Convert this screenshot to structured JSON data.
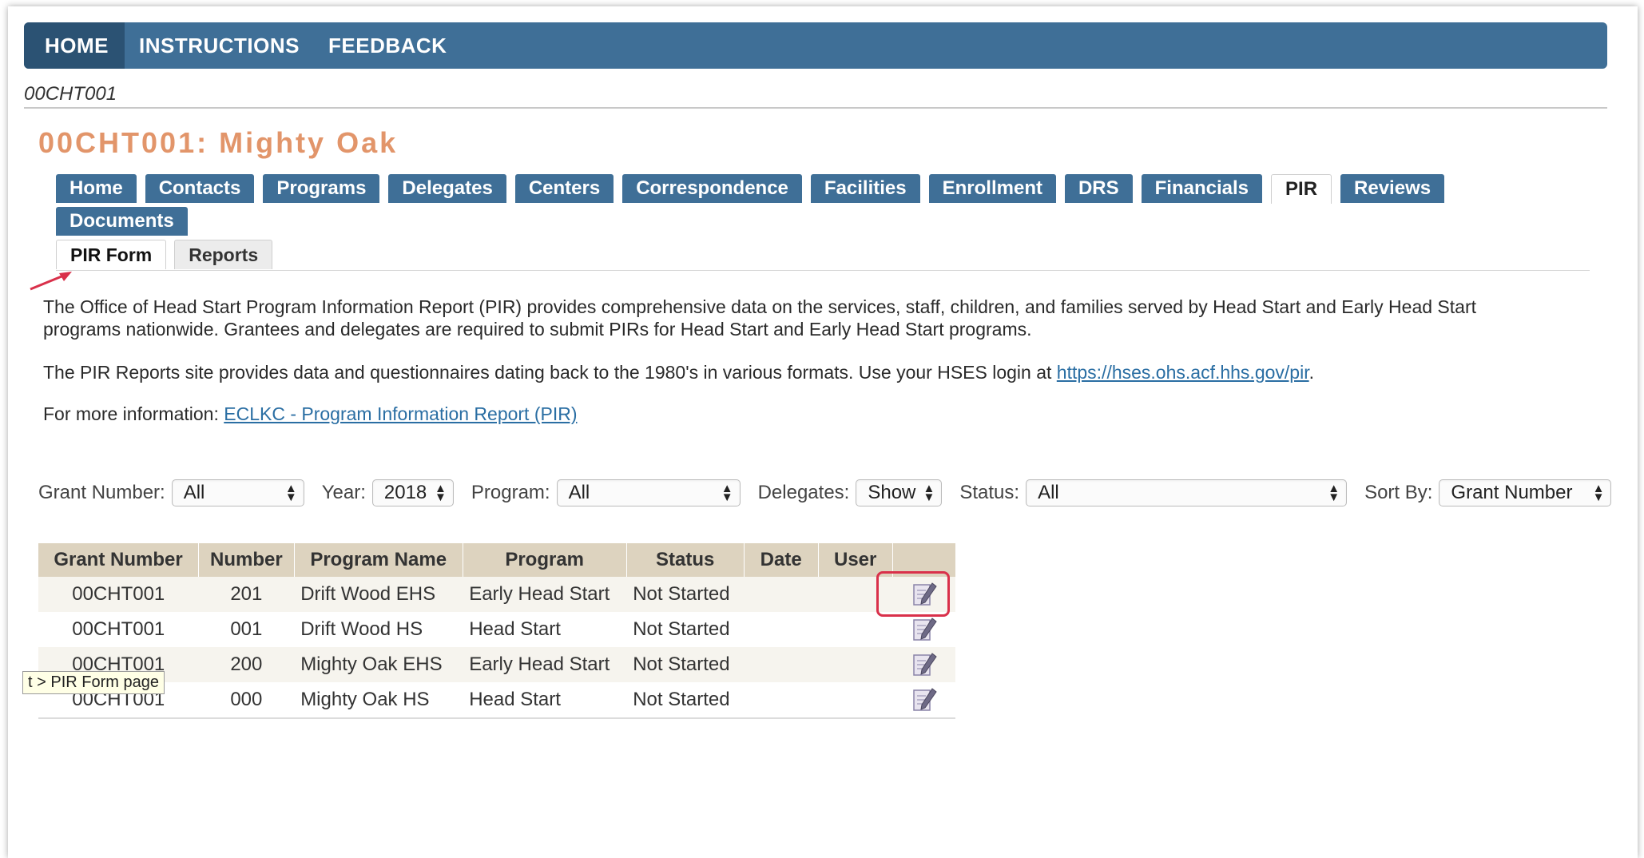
{
  "topnav": {
    "items": [
      "HOME",
      "INSTRUCTIONS",
      "FEEDBACK"
    ]
  },
  "breadcrumb": "00CHT001",
  "page_title": "00CHT001: Mighty Oak",
  "tabs": [
    "Home",
    "Contacts",
    "Programs",
    "Delegates",
    "Centers",
    "Correspondence",
    "Facilities",
    "Enrollment",
    "DRS",
    "Financials",
    "PIR",
    "Reviews",
    "Documents"
  ],
  "active_tab": "PIR",
  "subtabs": [
    "PIR Form",
    "Reports"
  ],
  "paragraphs": {
    "p1_line1": "The Office of Head Start Program Information Report (PIR) provides comprehensive data on the services, staff, children, and families served by Head Start and Early Head Start",
    "p1_line2": "programs nationwide. Grantees and delegates are required to submit PIRs for Head Start and Early Head Start programs.",
    "p2_text": "The PIR Reports site provides data and questionnaires dating back to the 1980's in various formats. Use your HSES login at ",
    "p2_link": "https://hses.ohs.acf.hhs.gov/pir",
    "p2_end": ".",
    "p3_text": "For more information: ",
    "p3_link": "ECLKC - Program Information Report (PIR)"
  },
  "filters": {
    "grant_number": {
      "label": "Grant Number:",
      "value": "All"
    },
    "year": {
      "label": "Year:",
      "value": "2018"
    },
    "program": {
      "label": "Program:",
      "value": "All"
    },
    "delegates": {
      "label": "Delegates:",
      "value": "Show"
    },
    "status": {
      "label": "Status:",
      "value": "All"
    },
    "sort_by": {
      "label": "Sort By:",
      "value": "Grant Number"
    }
  },
  "table": {
    "headers": [
      "Grant Number",
      "Number",
      "Program Name",
      "Program",
      "Status",
      "Date",
      "User",
      ""
    ],
    "rows": [
      {
        "grant": "00CHT001",
        "number": "201",
        "program_name": "Drift Wood EHS",
        "program": "Early Head Start",
        "status": "Not Started",
        "date": "",
        "user": ""
      },
      {
        "grant": "00CHT001",
        "number": "001",
        "program_name": "Drift Wood HS",
        "program": "Head Start",
        "status": "Not Started",
        "date": "",
        "user": ""
      },
      {
        "grant": "00CHT001",
        "number": "200",
        "program_name": "Mighty Oak EHS",
        "program": "Early Head Start",
        "status": "Not Started",
        "date": "",
        "user": ""
      },
      {
        "grant": "00CHT001",
        "number": "000",
        "program_name": "Mighty Oak HS",
        "program": "Head Start",
        "status": "Not Started",
        "date": "",
        "user": ""
      }
    ]
  },
  "tooltip": "t > PIR Form page",
  "icons": {
    "edit": "edit-form-icon",
    "annotation": "red-arrow"
  },
  "colors": {
    "nav": "#3f6f97",
    "title": "#e2956a",
    "header": "#ddd3bf",
    "highlight": "#d9304a"
  }
}
